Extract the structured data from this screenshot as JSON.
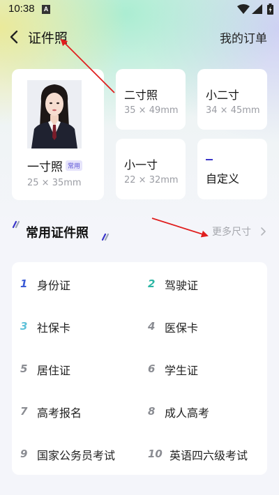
{
  "status": {
    "time": "10:38",
    "notif_letter": "A"
  },
  "header": {
    "title": "证件照",
    "orders_label": "我的订单"
  },
  "sizes": [
    {
      "name": "一寸照",
      "dim": "25 × 35mm",
      "badge": "常用"
    },
    {
      "name": "二寸照",
      "dim": "35 × 49mm"
    },
    {
      "name": "小二寸",
      "dim": "34 × 45mm"
    },
    {
      "name": "小一寸",
      "dim": "22 × 32mm"
    },
    {
      "name": "自定义"
    }
  ],
  "section": {
    "title": "常用证件照",
    "more_label": "更多尺寸"
  },
  "list": [
    {
      "num": "1",
      "label": "身份证"
    },
    {
      "num": "2",
      "label": "驾驶证"
    },
    {
      "num": "3",
      "label": "社保卡"
    },
    {
      "num": "4",
      "label": "医保卡"
    },
    {
      "num": "5",
      "label": "居住证"
    },
    {
      "num": "6",
      "label": "学生证"
    },
    {
      "num": "7",
      "label": "高考报名"
    },
    {
      "num": "8",
      "label": "成人高考"
    },
    {
      "num": "9",
      "label": "国家公务员考试"
    },
    {
      "num": "10",
      "label": "英语四六级考试"
    }
  ],
  "colors": {
    "accent": "#3a35c8",
    "num_1": "#3b5bd6",
    "num_2": "#2cb6a4",
    "num_3": "#5ec1d9",
    "num_other": "#8a8c92",
    "annotation_arrow": "#e01e1e"
  },
  "icons": {
    "back": "chevron-left-icon",
    "more": "chevron-right-icon",
    "wifi": "wifi-icon",
    "signal": "signal-icon",
    "battery": "battery-icon"
  }
}
